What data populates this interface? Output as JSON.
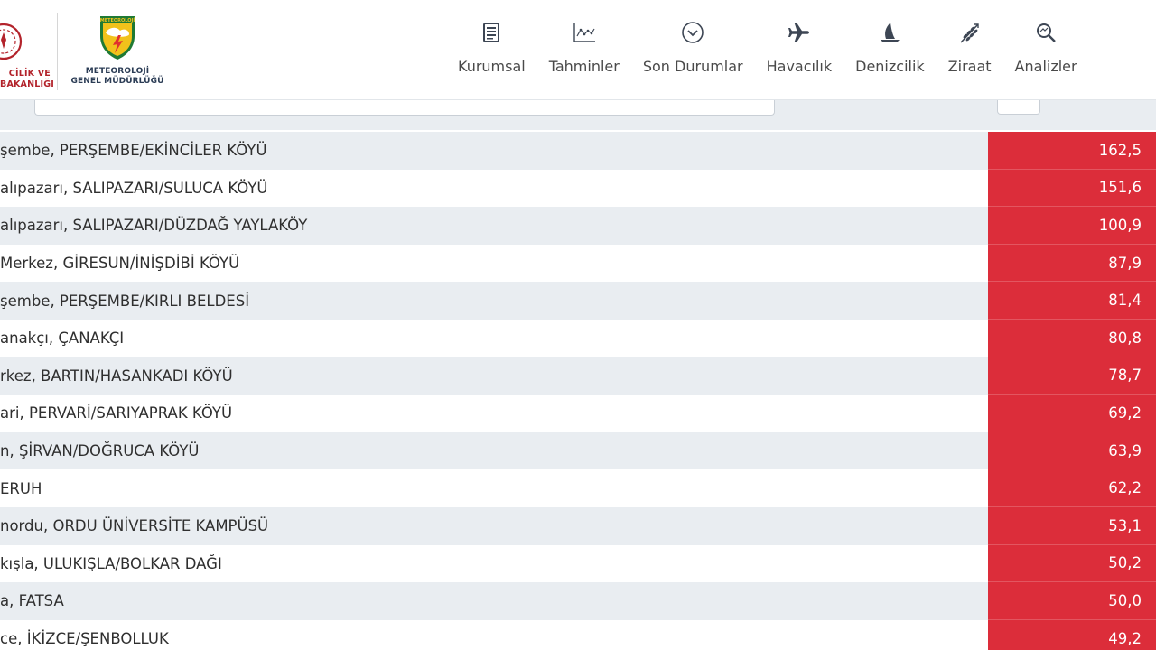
{
  "header": {
    "ministry_text": "ÇEVRE, ŞEHİRCİLİK VE\nİKLİM DEĞİŞİKLİĞİ BAKANLIĞI",
    "ministry_text_visible": "CİLİK VE\nBAKANLIĞI",
    "mgm_logo_top": "METEOROLOJİ",
    "mgm_text_line1": "METEOROLOJİ",
    "mgm_text_line2": "GENEL MÜDÜRLÜĞÜ"
  },
  "nav": {
    "items": [
      {
        "label": "Kurumsal",
        "icon": "document-icon"
      },
      {
        "label": "Tahminler",
        "icon": "chart-icon"
      },
      {
        "label": "Son Durumlar",
        "icon": "chevron-circle-icon"
      },
      {
        "label": "Havacılık",
        "icon": "airplane-icon"
      },
      {
        "label": "Denizcilik",
        "icon": "sailboat-icon"
      },
      {
        "label": "Ziraat",
        "icon": "wheat-icon"
      },
      {
        "label": "Analizler",
        "icon": "search-analysis-icon"
      }
    ]
  },
  "colors": {
    "value_cell": "#dc2d3a",
    "row_alt": "#e9edf1",
    "nav_icon": "#3d4654"
  },
  "table": {
    "rows": [
      {
        "name": "şembe, PERŞEMBE/EKİNCİLER KÖYÜ",
        "value": "162,5"
      },
      {
        "name": "alıpazarı, SALIPAZARI/SULUCA KÖYÜ",
        "value": "151,6"
      },
      {
        "name": "alıpazarı, SALIPAZARI/DÜZDAĞ YAYLAKÖY",
        "value": "100,9"
      },
      {
        "name": "Merkez, GİRESUN/İNİŞDİBİ KÖYÜ",
        "value": "87,9"
      },
      {
        "name": "şembe, PERŞEMBE/KIRLI BELDESİ",
        "value": "81,4"
      },
      {
        "name": "anakçı, ÇANAKÇI",
        "value": "80,8"
      },
      {
        "name": "rkez, BARTIN/HASANKADI KÖYÜ",
        "value": "78,7"
      },
      {
        "name": "ari, PERVARİ/SARIYAPRAK KÖYÜ",
        "value": "69,2"
      },
      {
        "name": "n, ŞİRVAN/DOĞRUCA KÖYÜ",
        "value": "63,9"
      },
      {
        "name": " ERUH",
        "value": "62,2"
      },
      {
        "name": "nordu, ORDU ÜNİVERSİTE KAMPÜSÜ",
        "value": "53,1"
      },
      {
        "name": "kışla, ULUKIŞLA/BOLKAR DAĞI",
        "value": "50,2"
      },
      {
        "name": "a, FATSA",
        "value": "50,0"
      },
      {
        "name": "ce, İKİZCE/ŞENBOLLUK",
        "value": "49,2"
      }
    ]
  }
}
